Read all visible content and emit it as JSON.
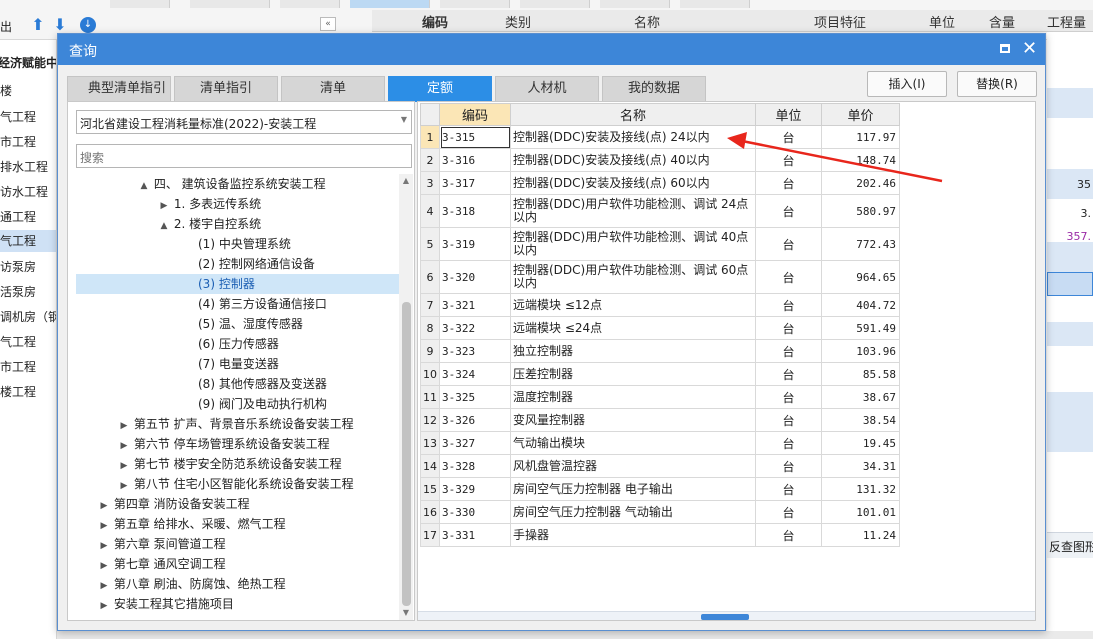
{
  "app": {
    "export_label": "出",
    "column_headers": [
      "编码",
      "类别",
      "名称",
      "项目特征",
      "单位",
      "含量",
      "工程量"
    ],
    "sidebar_items": [
      "经济赋能中",
      "楼",
      "气工程",
      "市工程",
      "排水工程",
      "访水工程",
      "通工程",
      "气工程",
      "访泵房",
      "活泵房",
      "调机房（钢",
      "气工程",
      "市工程",
      "楼工程"
    ],
    "right_values": [
      "35",
      "3.",
      "357."
    ],
    "reverse_label": "反查图形"
  },
  "dialog": {
    "title": "查询",
    "tabs": [
      "典型清单指引",
      "清单指引",
      "清单",
      "定额",
      "人材机",
      "我的数据"
    ],
    "active_tab": "定额",
    "insert_button": "插入(I)",
    "replace_button": "替换(R)",
    "standard_select": "河北省建设工程消耗量标准(2022)-安装工程",
    "search_placeholder": "搜索",
    "tree": [
      {
        "label": "四、 建筑设备监控系统安装工程",
        "arrow": "▲"
      },
      {
        "label": "1. 多表远传系统",
        "arrow": "▶"
      },
      {
        "label": "2. 楼宇自控系统",
        "arrow": "▲"
      },
      {
        "label": "(1) 中央管理系统",
        "arrow": ""
      },
      {
        "label": "(2) 控制网络通信设备",
        "arrow": ""
      },
      {
        "label": "(3) 控制器",
        "arrow": ""
      },
      {
        "label": "(4) 第三方设备通信接口",
        "arrow": ""
      },
      {
        "label": "(5) 温、湿度传感器",
        "arrow": ""
      },
      {
        "label": "(6) 压力传感器",
        "arrow": ""
      },
      {
        "label": "(7) 电量变送器",
        "arrow": ""
      },
      {
        "label": "(8) 其他传感器及变送器",
        "arrow": ""
      },
      {
        "label": "(9) 阀门及电动执行机构",
        "arrow": ""
      },
      {
        "label": "第五节 扩声、背景音乐系统设备安装工程",
        "arrow": "▶"
      },
      {
        "label": "第六节 停车场管理系统设备安装工程",
        "arrow": "▶"
      },
      {
        "label": "第七节 楼宇安全防范系统设备安装工程",
        "arrow": "▶"
      },
      {
        "label": "第八节 住宅小区智能化系统设备安装工程",
        "arrow": "▶"
      },
      {
        "label": "第四章 消防设备安装工程",
        "arrow": "▶"
      },
      {
        "label": "第五章 给排水、采暖、燃气工程",
        "arrow": "▶"
      },
      {
        "label": "第六章 泵间管道工程",
        "arrow": "▶"
      },
      {
        "label": "第七章 通风空调工程",
        "arrow": "▶"
      },
      {
        "label": "第八章 刷油、防腐蚀、绝热工程",
        "arrow": "▶"
      },
      {
        "label": "安装工程其它措施项目",
        "arrow": "▶"
      }
    ],
    "selected_tree_item": "(3) 控制器",
    "grid": {
      "headers": [
        "",
        "编码",
        "名称",
        "单位",
        "单价"
      ],
      "rows": [
        {
          "no": "1",
          "code": "3-315",
          "name": "控制器(DDC)安装及接线(点) 24以内",
          "unit": "台",
          "price": "117.97"
        },
        {
          "no": "2",
          "code": "3-316",
          "name": "控制器(DDC)安装及接线(点) 40以内",
          "unit": "台",
          "price": "148.74"
        },
        {
          "no": "3",
          "code": "3-317",
          "name": "控制器(DDC)安装及接线(点) 60以内",
          "unit": "台",
          "price": "202.46"
        },
        {
          "no": "4",
          "code": "3-318",
          "name": "控制器(DDC)用户软件功能检测、调试 24点以内",
          "unit": "台",
          "price": "580.97"
        },
        {
          "no": "5",
          "code": "3-319",
          "name": "控制器(DDC)用户软件功能检测、调试 40点以内",
          "unit": "台",
          "price": "772.43"
        },
        {
          "no": "6",
          "code": "3-320",
          "name": "控制器(DDC)用户软件功能检测、调试 60点以内",
          "unit": "台",
          "price": "964.65"
        },
        {
          "no": "7",
          "code": "3-321",
          "name": "远端模块 ≤12点",
          "unit": "台",
          "price": "404.72"
        },
        {
          "no": "8",
          "code": "3-322",
          "name": "远端模块 ≤24点",
          "unit": "台",
          "price": "591.49"
        },
        {
          "no": "9",
          "code": "3-323",
          "name": "独立控制器",
          "unit": "台",
          "price": "103.96"
        },
        {
          "no": "10",
          "code": "3-324",
          "name": "压差控制器",
          "unit": "台",
          "price": "85.58"
        },
        {
          "no": "11",
          "code": "3-325",
          "name": "温度控制器",
          "unit": "台",
          "price": "38.67"
        },
        {
          "no": "12",
          "code": "3-326",
          "name": "变风量控制器",
          "unit": "台",
          "price": "38.54"
        },
        {
          "no": "13",
          "code": "3-327",
          "name": "气动输出模块",
          "unit": "台",
          "price": "19.45"
        },
        {
          "no": "14",
          "code": "3-328",
          "name": "风机盘管温控器",
          "unit": "台",
          "price": "34.31"
        },
        {
          "no": "15",
          "code": "3-329",
          "name": "房间空气压力控制器 电子输出",
          "unit": "台",
          "price": "131.32"
        },
        {
          "no": "16",
          "code": "3-330",
          "name": "房间空气压力控制器 气动输出",
          "unit": "台",
          "price": "101.01"
        },
        {
          "no": "17",
          "code": "3-331",
          "name": "手操器",
          "unit": "台",
          "price": "11.24"
        }
      ]
    }
  },
  "colors": {
    "titlebar": "#3d86d8",
    "active_tab": "#2c8ee6",
    "annotation_arrow": "#e8261c",
    "selected_row": "#cfe6f8",
    "active_header": "#fbe6b6"
  }
}
